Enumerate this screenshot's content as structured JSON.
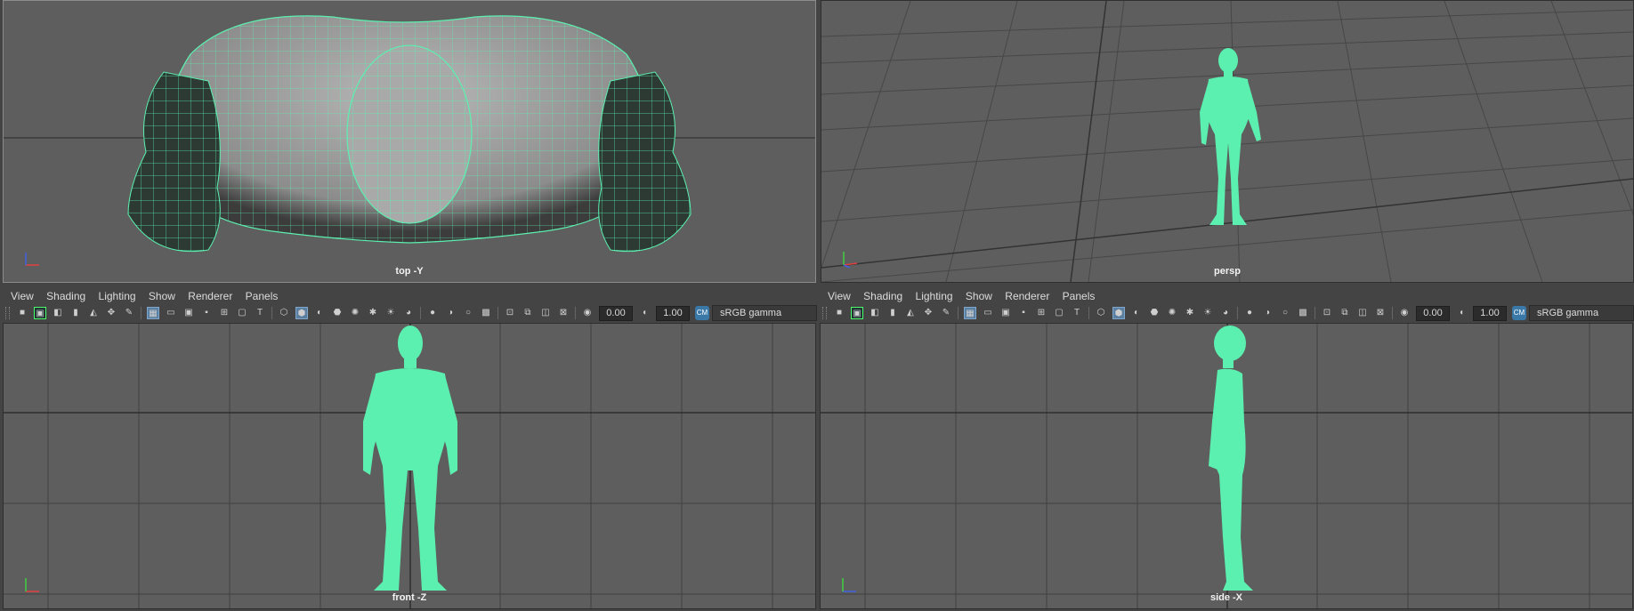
{
  "viewports": {
    "top": {
      "camera_label": "top -Y"
    },
    "persp": {
      "camera_label": "persp"
    },
    "front": {
      "camera_label": "front -Z"
    },
    "side": {
      "camera_label": "side -X"
    }
  },
  "panel_menu": {
    "view": "View",
    "shading": "Shading",
    "lighting": "Lighting",
    "show": "Show",
    "renderer": "Renderer",
    "panels": "Panels"
  },
  "panel_toolbar": {
    "exposure_value": "0.00",
    "gamma_value": "1.00",
    "color_space": "sRGB gamma",
    "icons": [
      "camera-icon",
      "camera-lock-icon",
      "camera-attributes-icon",
      "bookmark-icon",
      "image-plane-icon",
      "2d-pan-zoom-icon",
      "grease-pencil-icon",
      "grid-icon",
      "film-gate-icon",
      "resolution-gate-icon",
      "gate-mask-icon",
      "field-chart-icon",
      "safe-action-icon",
      "safe-title-icon",
      "wireframe-icon",
      "smooth-shade-icon",
      "default-material-icon",
      "textured-icon",
      "use-all-lights-icon",
      "shadows-icon",
      "screen-space-ao-icon",
      "motion-blur-icon",
      "multisample-aa-icon",
      "depth-of-field-icon",
      "isolate-select-icon",
      "xray-icon",
      "xray-active-icon",
      "xray-joints-icon",
      "backface-culling-icon",
      "exposure-icon",
      "gamma-icon",
      "color-management-icon"
    ]
  },
  "colors": {
    "wireframe": "#5cf0b0",
    "viewport_bg": "#5e5e5e",
    "grid_line": "#3f3f3f",
    "ui_bg": "#444444"
  }
}
